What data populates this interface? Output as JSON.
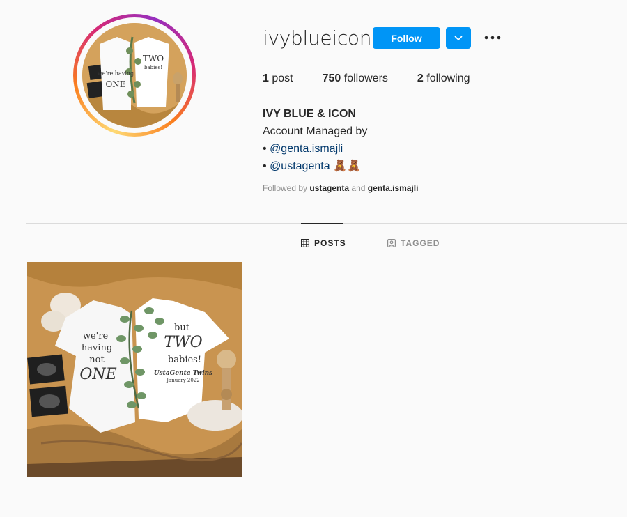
{
  "profile": {
    "username": "ivyblueicon",
    "follow_label": "Follow"
  },
  "stats": {
    "posts_count": "1",
    "posts_label": "post",
    "followers_count": "750",
    "followers_label": "followers",
    "following_count": "2",
    "following_label": "following"
  },
  "bio": {
    "name": "IVY BLUE & ICON",
    "line1": "Account Managed by",
    "bullet": "•",
    "mention1": "@genta.ismajli",
    "mention2": "@ustagenta",
    "emoji": "🧸🧸"
  },
  "followed_by": {
    "prefix": "Followed by",
    "user1": "ustagenta",
    "and": "and",
    "user2": "genta.ismajli"
  },
  "tabs": {
    "posts": "POSTS",
    "tagged": "TAGGED"
  },
  "post_image": {
    "onesie_left_text": [
      "we're",
      "having",
      "not",
      "ONE"
    ],
    "onesie_right_text": [
      "but",
      "TWO",
      "babies!"
    ],
    "signature": "UstaGenta Twins",
    "signature_date": "January 2022"
  },
  "colors": {
    "accent": "#0095f6",
    "link": "#00376b",
    "muted": "#8e8e8e"
  }
}
